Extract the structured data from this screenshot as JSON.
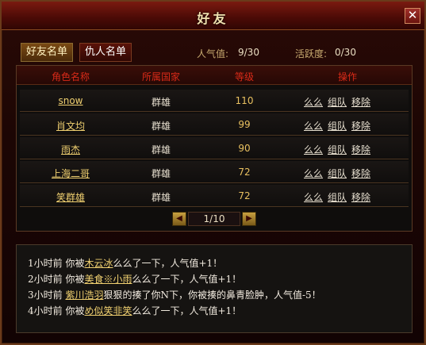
{
  "window": {
    "title": "好友",
    "close_label": "✕"
  },
  "tabs": {
    "friends": "好友名单",
    "enemies": "仇人名单"
  },
  "stats": {
    "popularity_label": "人气值:",
    "popularity_value": "9/30",
    "activity_label": "活跃度:",
    "activity_value": "0/30"
  },
  "table": {
    "headers": [
      "角色名称",
      "所属国家",
      "等级",
      "操作"
    ],
    "rows": [
      {
        "name": "snow",
        "country": "群雄",
        "level": "110"
      },
      {
        "name": "肖文均",
        "country": "群雄",
        "level": "99"
      },
      {
        "name": "雨杰",
        "country": "群雄",
        "level": "90"
      },
      {
        "name": "上海二哥",
        "country": "群雄",
        "level": "72"
      },
      {
        "name": "笑群雄",
        "country": "群雄",
        "level": "72"
      }
    ],
    "actions": [
      "么么",
      "组队",
      "移除"
    ]
  },
  "pager": {
    "prev_icon": "◀",
    "next_icon": "▶",
    "text": "1/10"
  },
  "messages": [
    {
      "pre": "1小时前 你被",
      "link": "木云冰",
      "post": "么么了一下，人气值+1！"
    },
    {
      "pre": "2小时前 你被",
      "link": "美食※小雨",
      "post": "么么了一下，人气值+1！"
    },
    {
      "pre": "3小时前 ",
      "link": "紫川浩羽",
      "post": "狠狠的揍了你N下，你被揍的鼻青脸肿，人气值-5！"
    },
    {
      "pre": "4小时前 你被",
      "link": "め似笑非笑",
      "post": "么么了一下，人气值+1！"
    }
  ]
}
